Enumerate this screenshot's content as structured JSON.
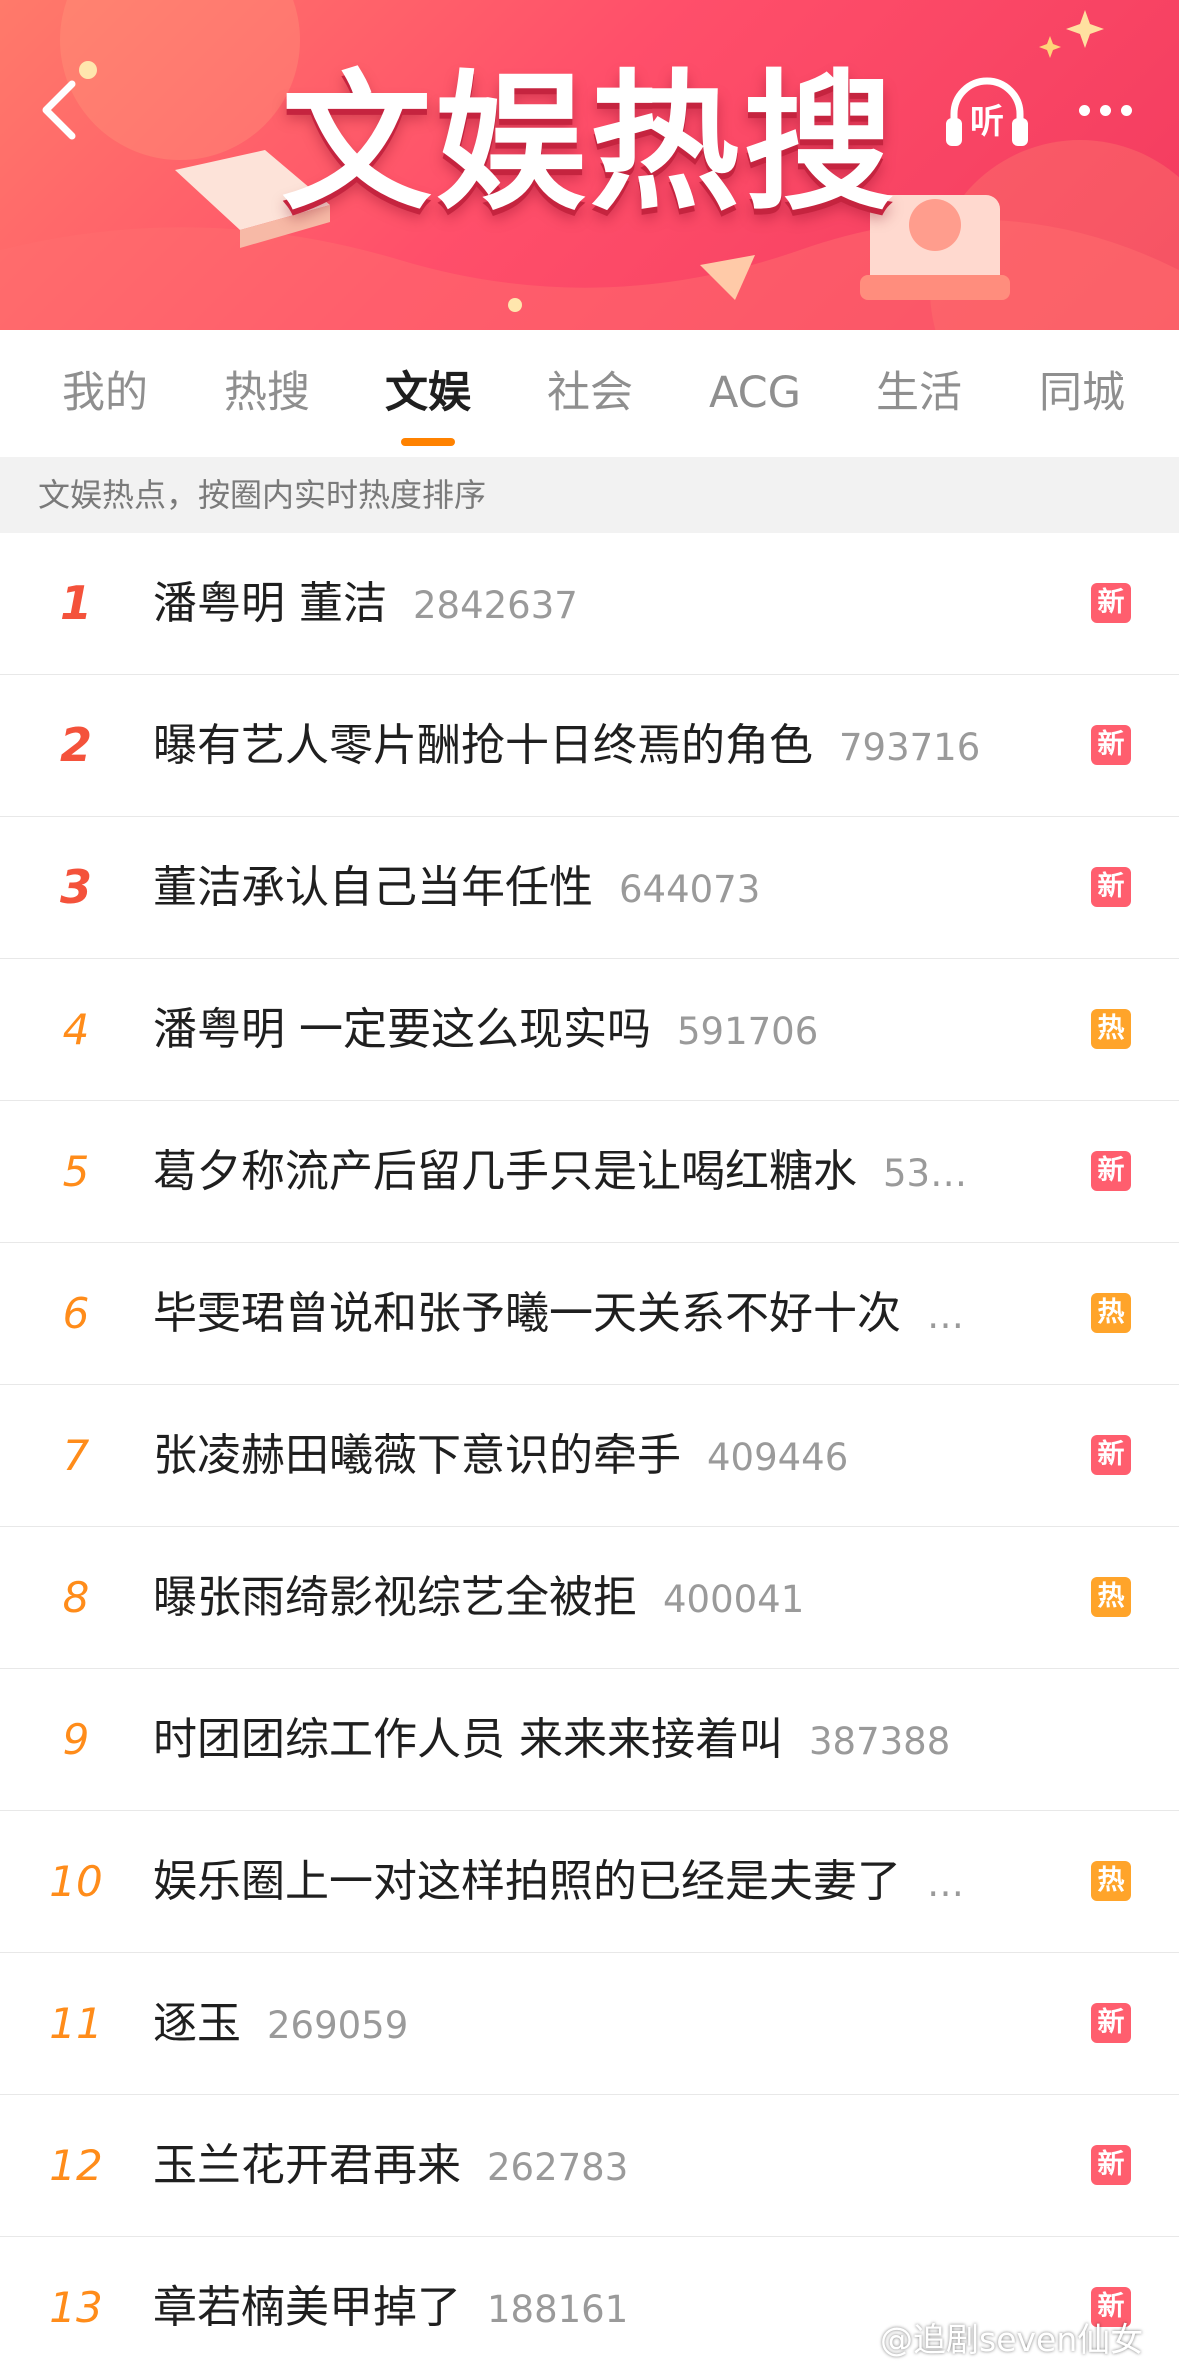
{
  "header": {
    "title": "文娱热搜",
    "listen_label": "听",
    "back_icon": "chevron-left-icon",
    "more_icon": "more-dots-icon"
  },
  "tabs": [
    {
      "label": "我的",
      "active": false
    },
    {
      "label": "热搜",
      "active": false
    },
    {
      "label": "文娱",
      "active": true
    },
    {
      "label": "社会",
      "active": false
    },
    {
      "label": "ACG",
      "active": false
    },
    {
      "label": "生活",
      "active": false
    },
    {
      "label": "同城",
      "active": false
    }
  ],
  "subtitle": "文娱热点，按圈内实时热度排序",
  "list": [
    {
      "rank": "1",
      "title": "潘粤明 董洁",
      "count": "2842637",
      "badge": "新",
      "badge_type": "new"
    },
    {
      "rank": "2",
      "title": "曝有艺人零片酬抢十日终焉的角色",
      "count": "793716",
      "badge": "新",
      "badge_type": "new"
    },
    {
      "rank": "3",
      "title": "董洁承认自己当年任性",
      "count": "644073",
      "badge": "新",
      "badge_type": "new"
    },
    {
      "rank": "4",
      "title": "潘粤明 一定要这么现实吗",
      "count": "591706",
      "badge": "热",
      "badge_type": "hot"
    },
    {
      "rank": "5",
      "title": "葛夕称流产后留几手只是让喝红糖水",
      "count": "53…",
      "badge": "新",
      "badge_type": "new"
    },
    {
      "rank": "6",
      "title": "毕雯珺曾说和张予曦一天关系不好十次",
      "count": "…",
      "badge": "热",
      "badge_type": "hot"
    },
    {
      "rank": "7",
      "title": "张凌赫田曦薇下意识的牵手",
      "count": "409446",
      "badge": "新",
      "badge_type": "new"
    },
    {
      "rank": "8",
      "title": "曝张雨绮影视综艺全被拒",
      "count": "400041",
      "badge": "热",
      "badge_type": "hot"
    },
    {
      "rank": "9",
      "title": "时团团综工作人员 来来来接着叫",
      "count": "387388",
      "badge": "",
      "badge_type": "none"
    },
    {
      "rank": "10",
      "title": "娱乐圈上一对这样拍照的已经是夫妻了",
      "count": "…",
      "badge": "热",
      "badge_type": "hot"
    },
    {
      "rank": "11",
      "title": "逐玉",
      "count": "269059",
      "badge": "新",
      "badge_type": "new"
    },
    {
      "rank": "12",
      "title": "玉兰花开君再来",
      "count": "262783",
      "badge": "新",
      "badge_type": "new"
    },
    {
      "rank": "13",
      "title": "章若楠美甲掉了",
      "count": "188161",
      "badge": "新",
      "badge_type": "new"
    }
  ],
  "watermark": "@追剧seven仙女",
  "colors": {
    "accent": "#ff8200",
    "rank_top": "#f4523b",
    "rank_other": "#ff8c1a",
    "badge_new": "#ff5e6e",
    "badge_hot": "#ffa42a"
  }
}
